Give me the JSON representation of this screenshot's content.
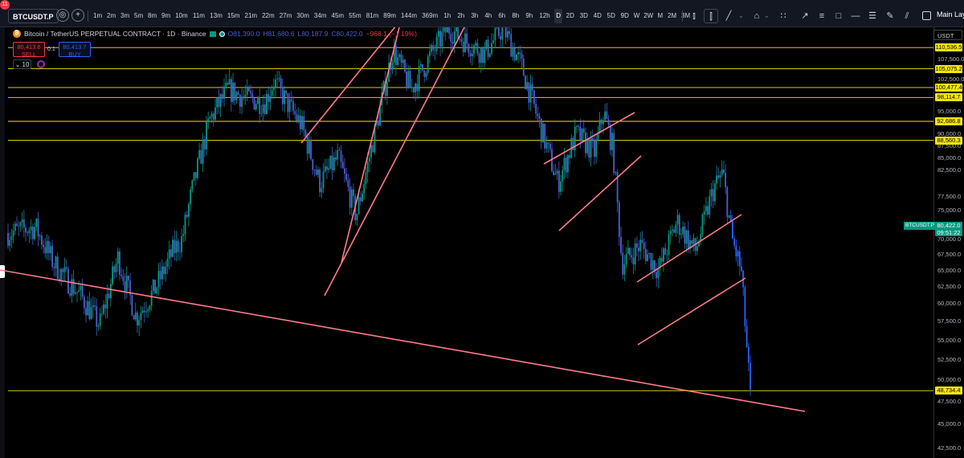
{
  "topbar": {
    "notification_count": "11",
    "symbol": "BTCUSDT.P",
    "intervals": [
      "1m",
      "2m",
      "3m",
      "5m",
      "8m",
      "9m",
      "10m",
      "11m",
      "13m",
      "15m",
      "21m",
      "22m",
      "27m",
      "30m",
      "34m",
      "45m",
      "55m",
      "81m",
      "89m",
      "144m",
      "369m",
      "1h",
      "2h",
      "3h",
      "4h",
      "6h",
      "8h",
      "9h",
      "12h",
      "D",
      "2D",
      "3D",
      "4D",
      "5D",
      "9D",
      "W",
      "2W",
      "M",
      "2M",
      "3M"
    ],
    "active_interval": "D",
    "layout_label": "Main Layo"
  },
  "legend": {
    "title": "Bitcoin / TetherUS PERPETUAL CONTRACT · 1D · Binance",
    "open_label": "O",
    "open": "81,390.0",
    "high_label": "H",
    "high": "81,680.6",
    "low_label": "L",
    "low": "80,187.9",
    "close_label": "C",
    "close": "80,422.0",
    "change": "−968.1 (−1.19%)"
  },
  "trade": {
    "sell_price": "80,413.6",
    "sell_label": "SELL",
    "spread": "0.1",
    "buy_price": "80,413.7",
    "buy_label": "BUY",
    "volume_lots": "10"
  },
  "price_axis": {
    "currency": "USDT",
    "ticks": [
      "107,500.0",
      "102,500.0",
      "95,000.0",
      "90,000.0",
      "87,500.0",
      "85,000.0",
      "82,500.0",
      "77,500.0",
      "75,000.0",
      "72,500.0",
      "70,000.0",
      "67,500.0",
      "65,000.0",
      "62,500.0",
      "60,000.0",
      "57,500.0",
      "55,000.0",
      "52,500.0",
      "50,000.0",
      "47,500.0",
      "45,000.0",
      "42,500.0"
    ],
    "horizontal_levels": [
      "110,536.5",
      "105,075.2",
      "100,477.4",
      "98,114.7",
      "92,686.8",
      "88,560.3",
      "48,734.4"
    ],
    "ticker_tag": "BTCUSDT.P",
    "last_price": "80,422.0",
    "countdown": "09:51:22"
  },
  "colors": {
    "up_candle": "#089981",
    "down_candle": "#4b5fd6",
    "current_candle": "#2962ff",
    "level_line": "#f7e600",
    "trendline": "#ff7a8c"
  },
  "chart_data": {
    "type": "candlestick",
    "y_scale": "log",
    "ylim": [
      41500,
      116000
    ],
    "horizontal_levels": [
      110536.5,
      105075.2,
      100477.4,
      98114.7,
      92686.8,
      88560.3,
      48734.4
    ],
    "last_price": 80422.0,
    "price_path": [
      [
        0,
        71000
      ],
      [
        3,
        72000
      ],
      [
        5,
        66000
      ],
      [
        8,
        61000
      ],
      [
        10,
        57000
      ],
      [
        12,
        67000
      ],
      [
        14,
        58000
      ],
      [
        16,
        62000
      ],
      [
        18,
        68000
      ],
      [
        19,
        70000
      ],
      [
        20,
        78000
      ],
      [
        22,
        93000
      ],
      [
        24,
        100000
      ],
      [
        26,
        98000
      ],
      [
        28,
        97000
      ],
      [
        29,
        102000
      ],
      [
        31,
        95000
      ],
      [
        32,
        92000
      ],
      [
        34,
        80000
      ],
      [
        36,
        85000
      ],
      [
        38,
        74000
      ],
      [
        40,
        90000
      ],
      [
        42,
        110000
      ],
      [
        44,
        100000
      ],
      [
        46,
        108000
      ],
      [
        48,
        116000
      ],
      [
        50,
        112000
      ],
      [
        52,
        109000
      ],
      [
        54,
        116000
      ],
      [
        56,
        106000
      ],
      [
        58,
        92000
      ],
      [
        60,
        80000
      ],
      [
        62,
        90000
      ],
      [
        64,
        86000
      ],
      [
        65,
        95000
      ],
      [
        66,
        87000
      ],
      [
        67,
        66000
      ],
      [
        69,
        69000
      ],
      [
        71,
        65000
      ],
      [
        73,
        73000
      ],
      [
        75,
        68000
      ],
      [
        77,
        79000
      ],
      [
        78,
        82000
      ],
      [
        79,
        70000
      ],
      [
        80,
        65000
      ],
      [
        81,
        48000
      ]
    ]
  }
}
